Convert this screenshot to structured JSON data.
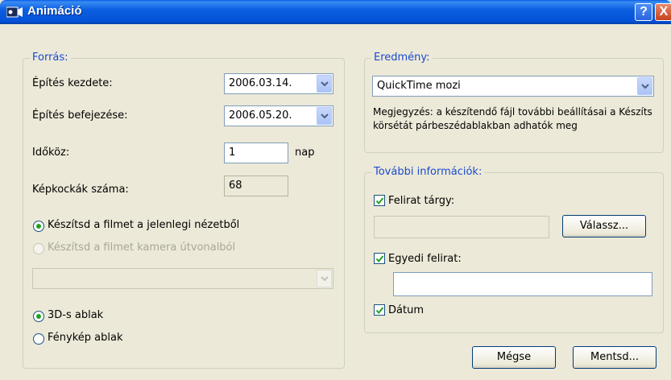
{
  "window": {
    "title": "Animáció",
    "help_label": "?",
    "close_label": "X"
  },
  "source": {
    "legend": "Forrás:",
    "start_label": "Építés kezdete:",
    "start_value": "2006.03.14.",
    "end_label": "Építés befejezése:",
    "end_value": "2006.05.20.",
    "interval_label": "Időköz:",
    "interval_value": "1",
    "interval_unit": "nap",
    "frames_label": "Képkockák száma:",
    "frames_value": "68",
    "radio_current_view": "Készítsd a filmet a jelenlegi nézetből",
    "radio_camera_path": "Készítsd a filmet kamera útvonalból",
    "radio_3d_window": "3D-s ablak",
    "radio_photo_window": "Fénykép ablak"
  },
  "result": {
    "legend": "Eredmény:",
    "format_value": "QuickTime mozi",
    "note_line1": "Megjegyzés: a készítendő fájl további beállításai a Készíts",
    "note_line2": "körsétát párbeszédablakban adhatók meg"
  },
  "more_info": {
    "legend": "További információk:",
    "caption_object_label": "Felirat tárgy:",
    "caption_object_value": "",
    "choose_button": "Válassz...",
    "custom_caption_label": "Egyedi felirat:",
    "custom_caption_value": "",
    "date_label": "Dátum"
  },
  "buttons": {
    "cancel": "Mégse",
    "save": "Mentsd..."
  },
  "colors": {
    "title_bar": "#0552d8",
    "legend_text": "#1a4ad0",
    "radio_dot": "#21a121",
    "dialog_bg": "#ece9d8"
  },
  "icons": [
    "app-icon",
    "help-icon",
    "close-icon",
    "chevron-down-icon",
    "checkmark-icon"
  ]
}
